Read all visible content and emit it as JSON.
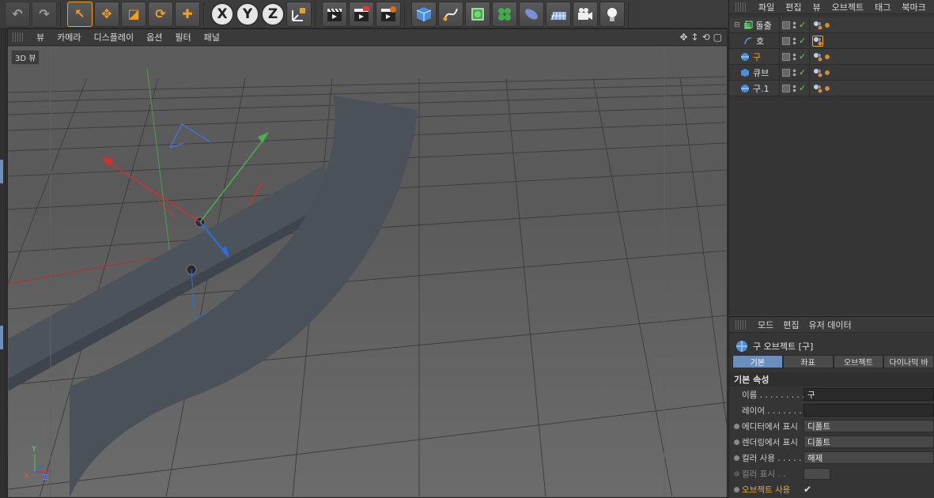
{
  "colors": {
    "accent": "#f5a623",
    "tab_active": "#6a8fbf",
    "check": "#6cd06c",
    "axis_x": "#d03030",
    "axis_y": "#4caf50",
    "axis_z": "#2a6fe0"
  },
  "toolbar": {
    "buttons": [
      {
        "name": "undo-icon",
        "glyph": "↶"
      },
      {
        "name": "redo-icon",
        "glyph": "↷"
      },
      {
        "name": "select-tool-icon",
        "glyph": "↖"
      },
      {
        "name": "move-tool-icon",
        "glyph": "✥"
      },
      {
        "name": "scale-tool-icon",
        "glyph": "◪"
      },
      {
        "name": "rotate-tool-icon",
        "glyph": "⟳"
      },
      {
        "name": "transform-tool-icon",
        "glyph": "✚"
      }
    ],
    "axis_x": "X",
    "axis_y": "Y",
    "axis_z": "Z"
  },
  "viewport": {
    "menu": [
      "뷰",
      "카메라",
      "디스플레이",
      "옵션",
      "필터",
      "패널"
    ],
    "label": "3D 뷰",
    "controls": [
      "✥",
      "↕",
      "⟲",
      "▢"
    ],
    "axes_label": {
      "x": "X",
      "y": "Y",
      "z": "Z"
    }
  },
  "object_manager": {
    "menu": [
      "파일",
      "편집",
      "뷰",
      "오브젝트",
      "태그",
      "북마크"
    ],
    "objects": [
      {
        "name": "돌출",
        "selected": false,
        "depth": 0
      },
      {
        "name": "호",
        "selected": false,
        "depth": 1
      },
      {
        "name": "구",
        "selected": true,
        "depth": 0
      },
      {
        "name": "큐브",
        "selected": false,
        "depth": 0
      },
      {
        "name": "구.1",
        "selected": false,
        "depth": 0
      }
    ]
  },
  "attributes": {
    "menu": [
      "모드",
      "편집",
      "유저 데이터"
    ],
    "title": "구 오브젝트 [구]",
    "tabs": [
      "기본",
      "좌표",
      "오브젝트",
      "다이나믹 바"
    ],
    "section": "기본 속성",
    "rows": {
      "name_label": "이름 . . . . . . . . .",
      "name_value": "구",
      "layer_label": "레이어 . . . . . . .",
      "layer_value": "",
      "editor_label": "에디터에서 표시",
      "editor_value": "디폴트",
      "render_label": "렌더링에서 표시",
      "render_value": "디폴트",
      "color_use_label": "컬러 사용 . . . . .",
      "color_use_value": "해제",
      "color_show_label": "컬러 표시 . .",
      "enable_label": "오브젝트 사용",
      "enable_value": "✔"
    }
  }
}
